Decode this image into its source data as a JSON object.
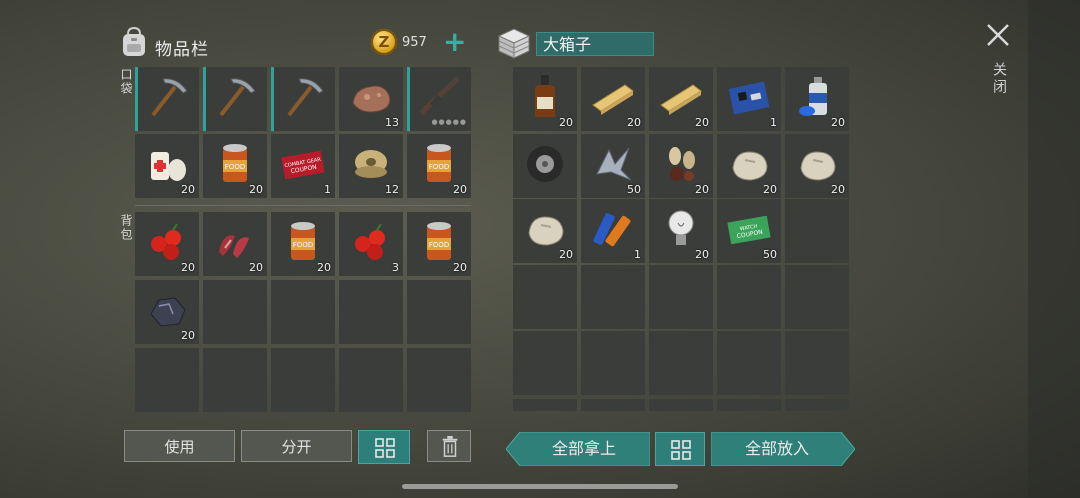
{
  "inventory": {
    "title": "物品栏",
    "coins": "957",
    "pocket_label": "口袋",
    "backpack_label": "背包",
    "pocket_items": [
      {
        "icon": "pickaxe-icon",
        "count": ""
      },
      {
        "icon": "pickaxe-icon",
        "count": ""
      },
      {
        "icon": "pickaxe-icon",
        "count": ""
      },
      {
        "icon": "ore-rock-icon",
        "count": "13"
      },
      {
        "icon": "rifle-icon",
        "count": ""
      },
      {
        "icon": "bandage-icon",
        "count": "20"
      },
      {
        "icon": "food-can-icon",
        "count": "20"
      },
      {
        "icon": "combat-gear-coupon-icon",
        "count": "1"
      },
      {
        "icon": "wire-spool-icon",
        "count": "12"
      },
      {
        "icon": "food-can-icon",
        "count": "20"
      }
    ],
    "backpack_items": [
      {
        "icon": "berries-icon",
        "count": "20"
      },
      {
        "icon": "raw-meat-icon",
        "count": "20"
      },
      {
        "icon": "food-can-icon",
        "count": "20"
      },
      {
        "icon": "berries-icon",
        "count": "3"
      },
      {
        "icon": "food-can-icon",
        "count": "20"
      },
      {
        "icon": "coal-icon",
        "count": "20"
      }
    ]
  },
  "box": {
    "name": "大箱子",
    "items": [
      {
        "icon": "whiskey-bottle-icon",
        "count": "20"
      },
      {
        "icon": "wood-plank-icon",
        "count": "20"
      },
      {
        "icon": "wood-plank-icon",
        "count": "20"
      },
      {
        "icon": "circuit-board-icon",
        "count": "1"
      },
      {
        "icon": "spray-can-icon",
        "count": "20"
      },
      {
        "icon": "tire-icon",
        "count": ""
      },
      {
        "icon": "scrap-metal-icon",
        "count": "50"
      },
      {
        "icon": "seeds-icon",
        "count": "20"
      },
      {
        "icon": "stone-icon",
        "count": "20"
      },
      {
        "icon": "stone-icon",
        "count": "20"
      },
      {
        "icon": "stone-icon",
        "count": "20"
      },
      {
        "icon": "batteries-icon",
        "count": "1"
      },
      {
        "icon": "light-bulb-icon",
        "count": "20"
      },
      {
        "icon": "watch-coupon-icon",
        "count": "50"
      }
    ]
  },
  "buttons": {
    "use": "使用",
    "split": "分开",
    "take_all": "全部拿上",
    "put_all": "全部放入",
    "close": "关闭"
  }
}
